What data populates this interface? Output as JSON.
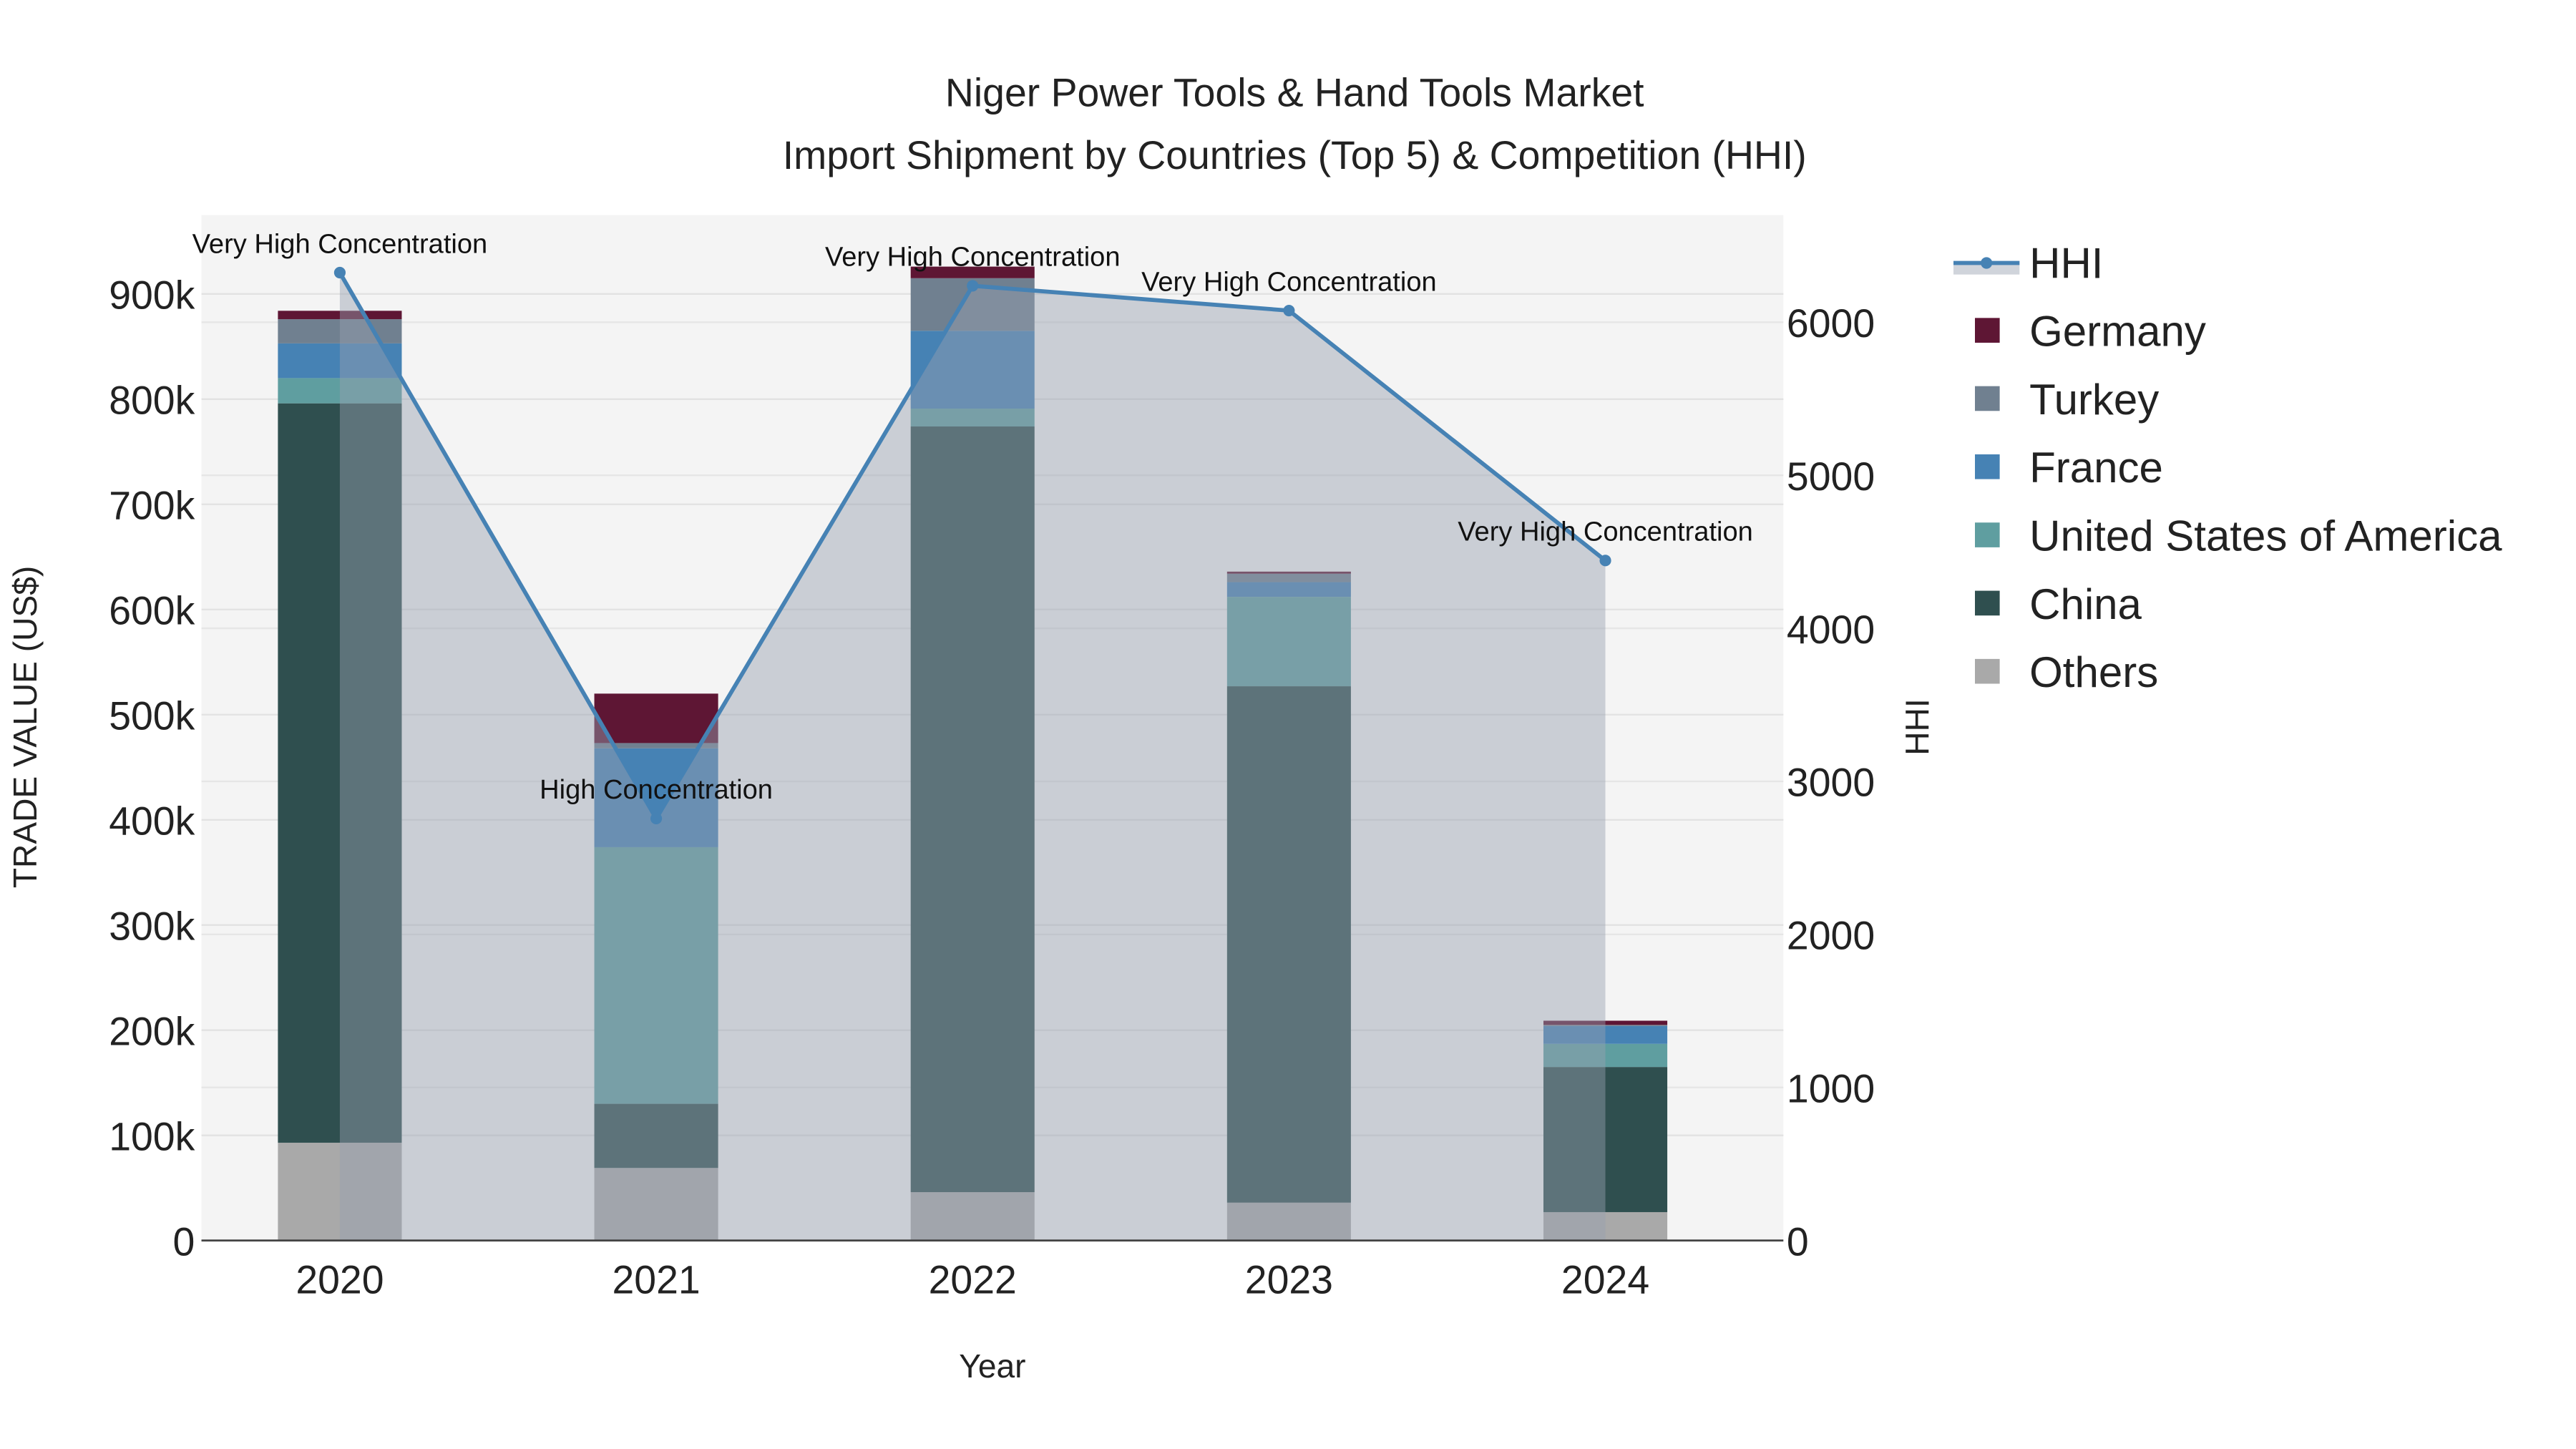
{
  "chart_data": {
    "type": "bar",
    "title_line1": "Niger Power Tools & Hand Tools Market",
    "title_line2": "Import Shipment by Countries (Top 5) & Competition (HHI)",
    "xlabel": "Year",
    "ylabel": "TRADE VALUE (US$)",
    "y2label": "HHI",
    "categories": [
      "2020",
      "2021",
      "2022",
      "2023",
      "2024"
    ],
    "ylim": [
      0,
      975000
    ],
    "y2lim": [
      0,
      6700
    ],
    "yticks": [
      0,
      100000,
      200000,
      300000,
      400000,
      500000,
      600000,
      700000,
      800000,
      900000
    ],
    "ytick_labels": [
      "0",
      "100k",
      "200k",
      "300k",
      "400k",
      "500k",
      "600k",
      "700k",
      "800k",
      "900k"
    ],
    "y2ticks": [
      0,
      1000,
      2000,
      3000,
      4000,
      5000,
      6000
    ],
    "y2tick_labels": [
      "0",
      "1000",
      "2000",
      "3000",
      "4000",
      "5000",
      "6000"
    ],
    "stack_order": [
      "Others",
      "China",
      "United States of America",
      "France",
      "Turkey",
      "Germany"
    ],
    "series": [
      {
        "name": "Others",
        "color": "#a9a9a9",
        "values": [
          93000,
          69000,
          46000,
          36000,
          27000
        ]
      },
      {
        "name": "China",
        "color": "#2f4f4f",
        "values": [
          703000,
          61000,
          728000,
          491000,
          138000
        ]
      },
      {
        "name": "United States of America",
        "color": "#5f9ea0",
        "values": [
          24000,
          244000,
          17000,
          85000,
          22000
        ]
      },
      {
        "name": "France",
        "color": "#4682b4",
        "values": [
          33000,
          94000,
          74000,
          14000,
          17000
        ]
      },
      {
        "name": "Turkey",
        "color": "#708090",
        "values": [
          23000,
          5000,
          50000,
          8000,
          1000
        ]
      },
      {
        "name": "Germany",
        "color": "#5e1634",
        "values": [
          8000,
          47000,
          11000,
          2000,
          4000
        ]
      }
    ],
    "hhi": {
      "name": "HHI",
      "color": "#4682b4",
      "values": [
        6324,
        2757,
        6238,
        6076,
        4443
      ]
    },
    "annotations": [
      "Very High Concentration",
      "High Concentration",
      "Very High Concentration",
      "Very High Concentration",
      "Very High Concentration"
    ],
    "legend_order": [
      "HHI",
      "Germany",
      "Turkey",
      "France",
      "United States of America",
      "China",
      "Others"
    ],
    "legend_position": "right",
    "grid": true
  }
}
